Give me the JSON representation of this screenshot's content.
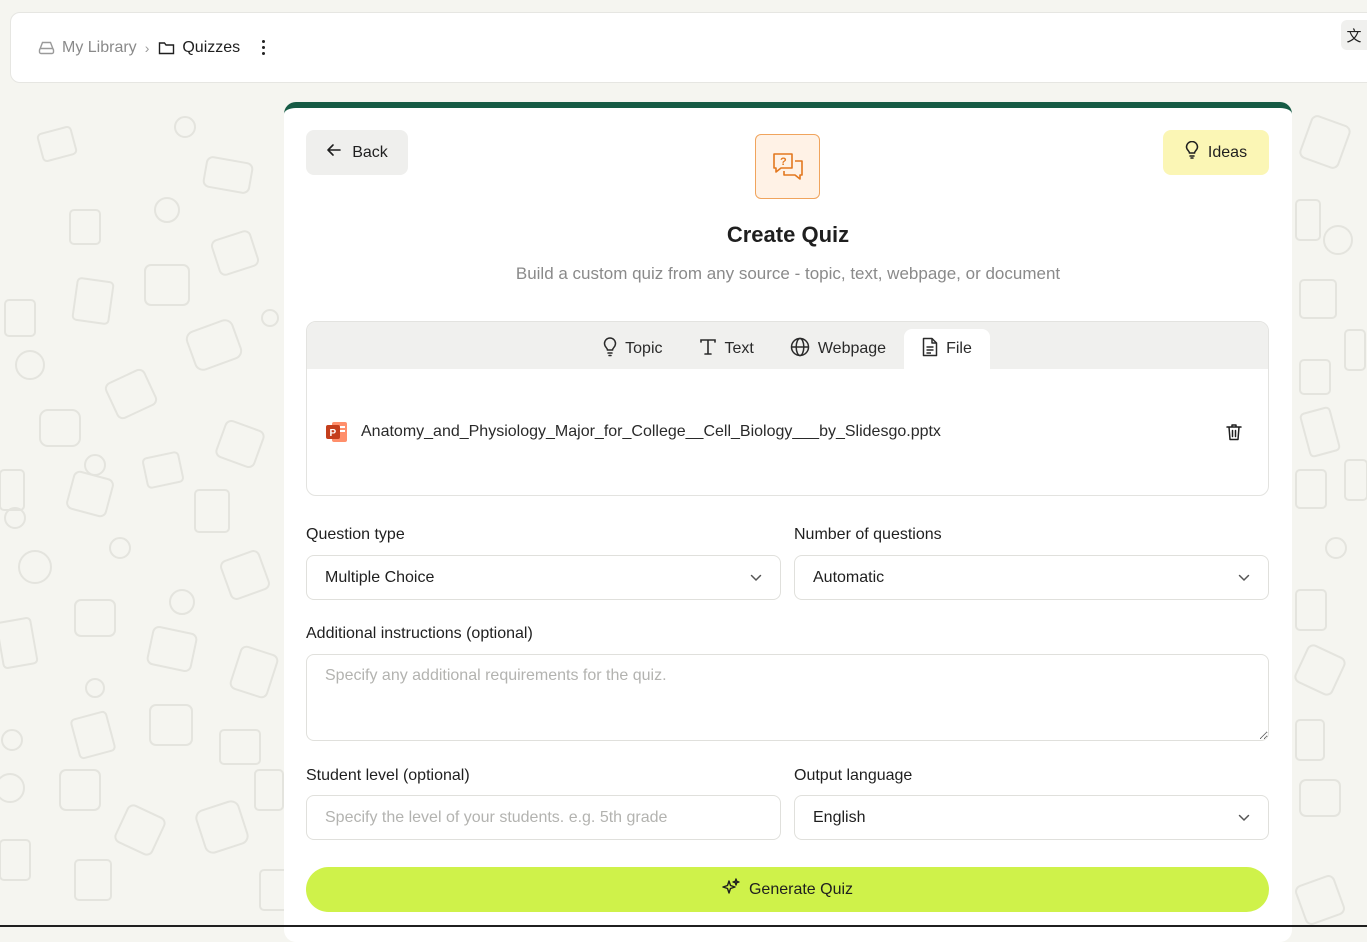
{
  "breadcrumb": {
    "library": "My Library",
    "separator": "›",
    "current": "Quizzes",
    "translate_glyph": "文"
  },
  "header": {
    "back_label": "Back",
    "ideas_label": "Ideas",
    "title": "Create Quiz",
    "subtitle": "Build a custom quiz from any source - topic, text, webpage, or document"
  },
  "source": {
    "tabs": [
      {
        "label": "Topic",
        "icon": "lightbulb-icon"
      },
      {
        "label": "Text",
        "icon": "text-icon"
      },
      {
        "label": "Webpage",
        "icon": "globe-icon"
      },
      {
        "label": "File",
        "icon": "file-icon",
        "active": true
      }
    ],
    "file": {
      "name": "Anatomy_and_Physiology_Major_for_College__Cell_Biology___by_Slidesgo.pptx",
      "icon": "powerpoint-icon"
    }
  },
  "form": {
    "question_type": {
      "label": "Question type",
      "value": "Multiple Choice"
    },
    "num_questions": {
      "label": "Number of questions",
      "value": "Automatic"
    },
    "instructions": {
      "label": "Additional instructions (optional)",
      "placeholder": "Specify any additional requirements for the quiz."
    },
    "student_level": {
      "label": "Student level (optional)",
      "placeholder": "Specify the level of your students. e.g. 5th grade"
    },
    "output_language": {
      "label": "Output language",
      "value": "English"
    },
    "generate_label": "Generate Quiz"
  },
  "colors": {
    "accent_dark": "#165b45",
    "generate": "#cff24a",
    "ideas_bg": "#fbf6b5",
    "hero_border": "#f0a45d"
  }
}
